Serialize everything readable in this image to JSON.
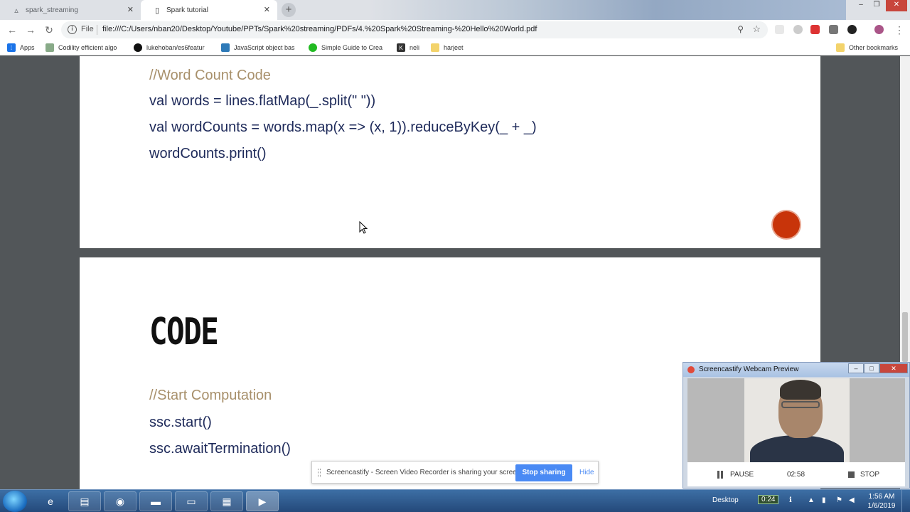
{
  "browser": {
    "tabs": [
      {
        "label": "spark_streaming",
        "active": false
      },
      {
        "label": "Spark tutorial",
        "active": true
      }
    ],
    "address": {
      "scheme_label": "File",
      "url": "file:///C:/Users/nban20/Desktop/Youtube/PPTs/Spark%20streaming/PDFs/4.%20Spark%20Streaming-%20Hello%20World.pdf"
    },
    "bookmarks": [
      {
        "label": "Apps",
        "icon": "apps-grid-icon"
      },
      {
        "label": "Codility efficient algo",
        "icon": "codility-icon"
      },
      {
        "label": "lukehoban/es6featur",
        "icon": "github-icon"
      },
      {
        "label": "JavaScript object bas",
        "icon": "js-icon"
      },
      {
        "label": "Simple Guide to Crea",
        "icon": "guide-icon"
      },
      {
        "label": "neli",
        "icon": "k-icon"
      },
      {
        "label": "harjeet",
        "icon": "folder-icon"
      }
    ],
    "other_bookmarks": "Other bookmarks"
  },
  "pdf": {
    "page1": {
      "comment": "//Word Count Code",
      "lines": [
        "val words = lines.flatMap(_.split(\" \"))",
        "val wordCounts = words.map(x => (x, 1)).reduceByKey(_ + _)",
        "wordCounts.print()"
      ]
    },
    "page2": {
      "title": "CODE",
      "comment": "//Start Computation",
      "lines": [
        "ssc.start()",
        "ssc.awaitTermination()"
      ]
    }
  },
  "sharebar": {
    "message": "Screencastify - Screen Video Recorder is sharing your screen.",
    "stop_label": "Stop sharing",
    "hide_label": "Hide"
  },
  "webcam": {
    "title": "Screencastify Webcam Preview",
    "pause_label": "PAUSE",
    "time": "02:58",
    "stop_label": "STOP"
  },
  "taskbar": {
    "desktop_label": "Desktop",
    "counter": "0:24",
    "time": "1:56 AM",
    "date": "1/6/2019"
  }
}
